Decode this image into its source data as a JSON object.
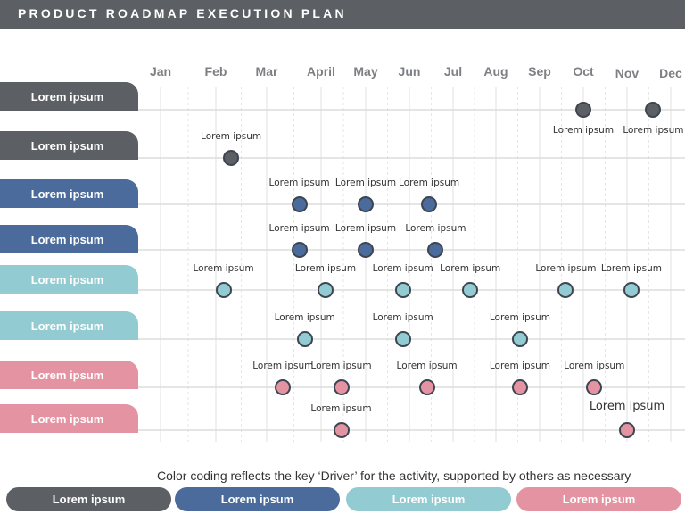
{
  "title": "PRODUCT ROADMAP EXECUTION PLAN",
  "colors": {
    "grey": "#5c5f64",
    "blue": "#4a6b9b",
    "teal": "#93cbd2",
    "pink": "#e493a2",
    "dot_border": "#3d4550",
    "grid": "#d9d9d9",
    "title_bar": "#5c5f64"
  },
  "months": [
    "Jan",
    "Feb",
    "Mar",
    "April",
    "May",
    "Jun",
    "Jul",
    "Aug",
    "Sep",
    "Oct",
    "Nov",
    "Dec"
  ],
  "rows": [
    {
      "label": "Lorem ipsum",
      "color": "grey",
      "milestones": [
        {
          "month": 10.0,
          "label": "Lorem ipsum",
          "label_pos": "below"
        },
        {
          "month": 11.6,
          "label": "Lorem ipsum",
          "label_pos": "below"
        }
      ]
    },
    {
      "label": "Lorem ipsum",
      "color": "grey",
      "milestones": [
        {
          "month": 2.3,
          "label": "Lorem ipsum",
          "label_pos": "above"
        }
      ]
    },
    {
      "label": "Lorem ipsum",
      "color": "blue",
      "milestones": [
        {
          "month": 3.6,
          "label": "Lorem ipsum",
          "label_pos": "above"
        },
        {
          "month": 5.0,
          "label": "Lorem ipsum",
          "label_pos": "above"
        },
        {
          "month": 6.45,
          "label": "Lorem ipsum",
          "label_pos": "above"
        }
      ]
    },
    {
      "label": "Lorem ipsum",
      "color": "blue",
      "milestones": [
        {
          "month": 3.6,
          "label": "Lorem ipsum",
          "label_pos": "above"
        },
        {
          "month": 5.0,
          "label": "Lorem ipsum",
          "label_pos": "above"
        },
        {
          "month": 6.6,
          "label": "Lorem ipsum",
          "label_pos": "above"
        }
      ]
    },
    {
      "label": "Lorem ipsum",
      "color": "teal",
      "milestones": [
        {
          "month": 2.15,
          "label": "Lorem ipsum",
          "label_pos": "above"
        },
        {
          "month": 4.1,
          "label": "Lorem ipsum",
          "label_pos": "above"
        },
        {
          "month": 5.85,
          "label": "Lorem ipsum",
          "label_pos": "above"
        },
        {
          "month": 7.4,
          "label": "Lorem ipsum",
          "label_pos": "above"
        },
        {
          "month": 9.6,
          "label": "Lorem ipsum",
          "label_pos": "above"
        },
        {
          "month": 11.1,
          "label": "Lorem ipsum",
          "label_pos": "above"
        }
      ]
    },
    {
      "label": "Lorem ipsum",
      "color": "teal",
      "milestones": [
        {
          "month": 3.7,
          "label": "Lorem ipsum",
          "label_pos": "above"
        },
        {
          "month": 5.85,
          "label": "Lorem ipsum",
          "label_pos": "above"
        },
        {
          "month": 8.55,
          "label": "Lorem ipsum",
          "label_pos": "above"
        }
      ]
    },
    {
      "label": "Lorem ipsum",
      "color": "pink",
      "milestones": [
        {
          "month": 3.3,
          "label": "Lorem ipsum",
          "label_pos": "above"
        },
        {
          "month": 4.45,
          "label": "Lorem ipsum",
          "label_pos": "above"
        },
        {
          "month": 6.4,
          "label": "Lorem ipsum",
          "label_pos": "above"
        },
        {
          "month": 8.55,
          "label": "Lorem ipsum",
          "label_pos": "above"
        },
        {
          "month": 10.25,
          "label": "Lorem ipsum",
          "label_pos": "above"
        }
      ]
    },
    {
      "label": "Lorem ipsum",
      "color": "pink",
      "milestones": [
        {
          "month": 4.45,
          "label": "Lorem ipsum",
          "label_pos": "above"
        },
        {
          "month": 11.0,
          "label": "Lorem ipsum",
          "label_pos": "above",
          "large": true
        }
      ]
    }
  ],
  "footnote": "Color coding reflects the key ‘Driver’ for the activity, supported by others as necessary",
  "legend": [
    {
      "label": "Lorem ipsum",
      "color": "grey"
    },
    {
      "label": "Lorem ipsum",
      "color": "blue"
    },
    {
      "label": "Lorem ipsum",
      "color": "teal"
    },
    {
      "label": "Lorem ipsum",
      "color": "pink"
    }
  ]
}
